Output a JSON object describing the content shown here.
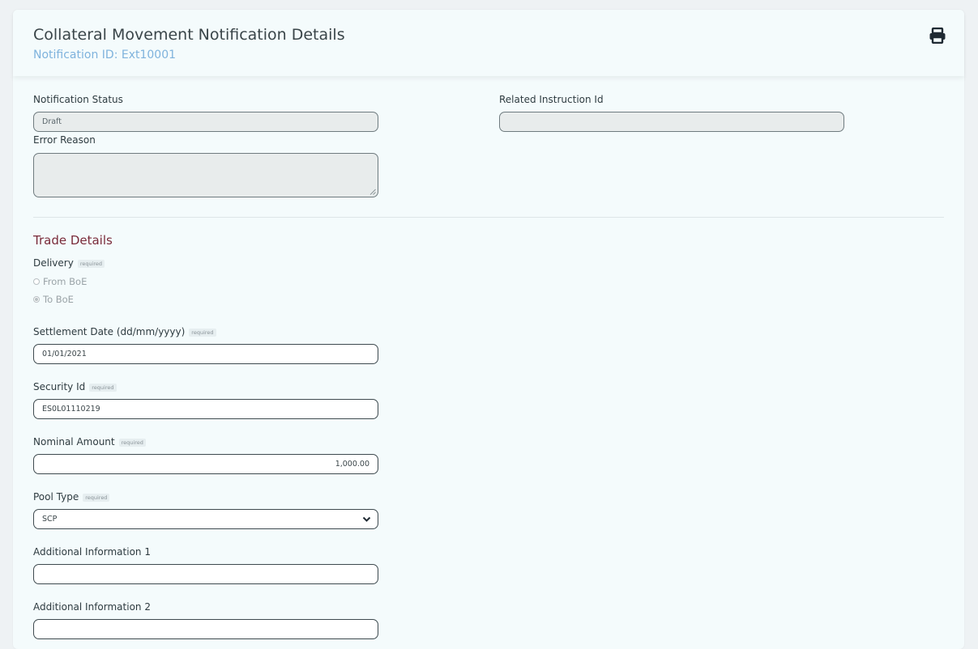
{
  "header": {
    "title": "Collateral Movement Notification Details",
    "subtitle": "Notification ID: Ext10001",
    "print_icon": "print-icon"
  },
  "status": {
    "notification_status_label": "Notification Status",
    "notification_status_value": "Draft",
    "related_instruction_label": "Related Instruction Id",
    "related_instruction_value": "",
    "error_reason_label": "Error Reason",
    "error_reason_value": ""
  },
  "trade": {
    "section_title": "Trade Details",
    "required_tag": "required",
    "delivery_label": "Delivery",
    "delivery_options": [
      {
        "label": "From BoE",
        "selected": false
      },
      {
        "label": "To BoE",
        "selected": true
      }
    ],
    "settlement_date_label": "Settlement Date (dd/mm/yyyy)",
    "settlement_date_value": "01/01/2021",
    "security_id_label": "Security Id",
    "security_id_value": "ES0L01110219",
    "nominal_amount_label": "Nominal Amount",
    "nominal_amount_value": "1,000.00",
    "pool_type_label": "Pool Type",
    "pool_type_value": "SCP",
    "additional_info_1_label": "Additional Information 1",
    "additional_info_1_value": "",
    "additional_info_2_label": "Additional Information 2",
    "additional_info_2_value": ""
  },
  "colors": {
    "page_bg": "#f4fbfc",
    "subtitle": "#7fb3dd",
    "section_title": "#7a2b3a",
    "disabled_field": "#e8ecec"
  }
}
